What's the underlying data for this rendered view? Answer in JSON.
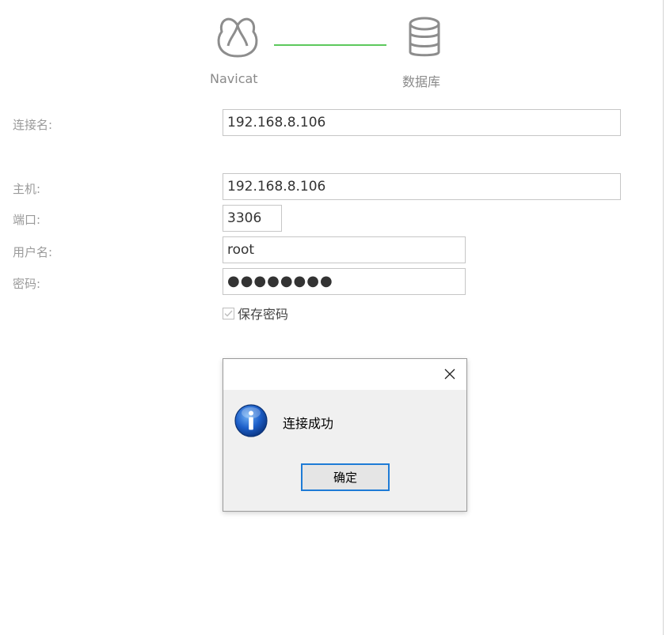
{
  "header": {
    "navicat_label": "Navicat",
    "database_label": "数据库",
    "navicat_icon": "navicat-logo-icon",
    "database_icon": "database-icon",
    "connector_color": "#5cc85c"
  },
  "form": {
    "connection_name_label": "连接名:",
    "connection_name_value": "192.168.8.106",
    "host_label": "主机:",
    "host_value": "192.168.8.106",
    "port_label": "端口:",
    "port_value": "3306",
    "username_label": "用户名:",
    "username_value": "root",
    "password_label": "密码:",
    "password_value": "●●●●●●●●",
    "save_password_label": "保存密码",
    "save_password_checked": true
  },
  "dialog": {
    "message": "连接成功",
    "ok_label": "确定",
    "close_icon": "close-icon",
    "info_icon": "info-icon",
    "accent_color": "#1e7bd6"
  }
}
